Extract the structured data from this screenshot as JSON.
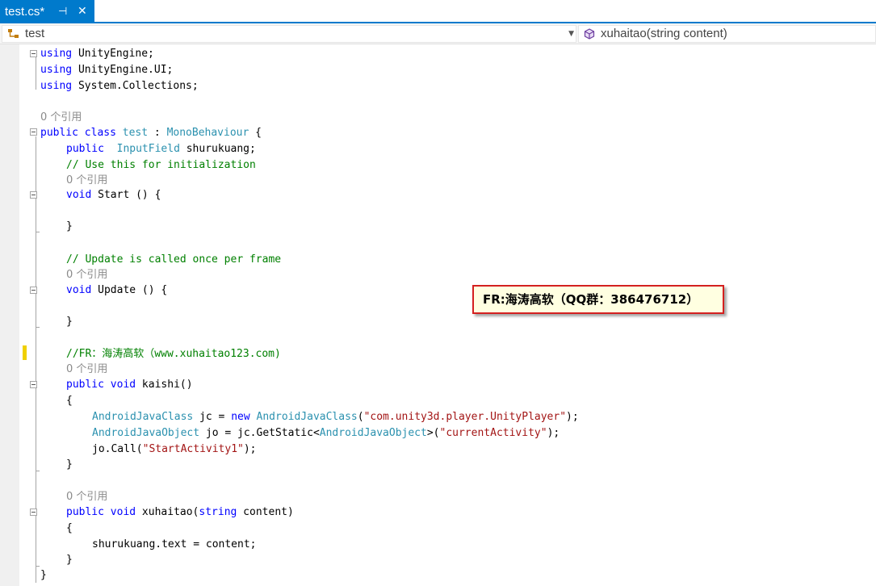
{
  "tab": {
    "title": "test.cs*",
    "pin_glyph": "⊣",
    "close_glyph": "✕"
  },
  "navbar": {
    "class_name": "test",
    "member_name": "xuhaitao(string content)",
    "class_icon": "class-icon",
    "member_icon": "method-icon"
  },
  "code": {
    "l1": {
      "kw": "using",
      "rest": " UnityEngine;"
    },
    "l2": {
      "kw": "using",
      "rest": " UnityEngine.UI;"
    },
    "l3": {
      "kw": "using",
      "rest": " System.Collections;"
    },
    "ref_class": "0 个引用",
    "class_decl": {
      "kw1": "public",
      "kw2": "class",
      "name": "test",
      "sep": " : ",
      "base": "MonoBehaviour",
      "brace": " {"
    },
    "field": {
      "kw": "public",
      "type": "InputField",
      "name": " shurukuang;"
    },
    "comment_init": "// Use this for initialization",
    "ref_start": "0 个引用",
    "start_decl": {
      "kw": "void",
      "rest": " Start () {"
    },
    "start_close": "}",
    "comment_update": "// Update is called once per frame",
    "ref_update": "0 个引用",
    "update_decl": {
      "kw": "void",
      "rest": " Update () {"
    },
    "update_close": "}",
    "comment_fr": "//FR：海涛高软（www.xuhaitao123.com)",
    "ref_kaishi": "0 个引用",
    "kaishi_decl": {
      "kw1": "public",
      "kw2": "void",
      "rest": " kaishi()"
    },
    "kaishi_open": "{",
    "line_jc": {
      "type": "AndroidJavaClass",
      "mid": " jc = ",
      "kw": "new",
      "type2": "AndroidJavaClass",
      "p1": "(",
      "str": "\"com.unity3d.player.UnityPlayer\"",
      "end": ");"
    },
    "line_jo": {
      "type": "AndroidJavaObject",
      "mid": " jo = jc.GetStatic<",
      "type2": "AndroidJavaObject",
      "p1": ">(",
      "str": "\"currentActivity\"",
      "end": ");"
    },
    "line_call": {
      "pre": "jo.Call(",
      "str": "\"StartActivity1\"",
      "end": ");"
    },
    "kaishi_close": "}",
    "ref_xuhaitao": "0 个引用",
    "xuhaitao_decl": {
      "kw1": "public",
      "kw2": "void",
      "name": " xuhaitao(",
      "kw3": "string",
      "rest": " content)"
    },
    "xuhaitao_open": "{",
    "assign": "shurukuang.text = content;",
    "xuhaitao_close": "}",
    "class_close": "}"
  },
  "callout": {
    "text": "FR:海涛高软（QQ群：386476712）"
  },
  "colors": {
    "accent": "#007acc",
    "keyword": "#0000ff",
    "type": "#2b91af",
    "comment": "#008000",
    "string": "#a31515",
    "callout_border": "#d42020"
  }
}
